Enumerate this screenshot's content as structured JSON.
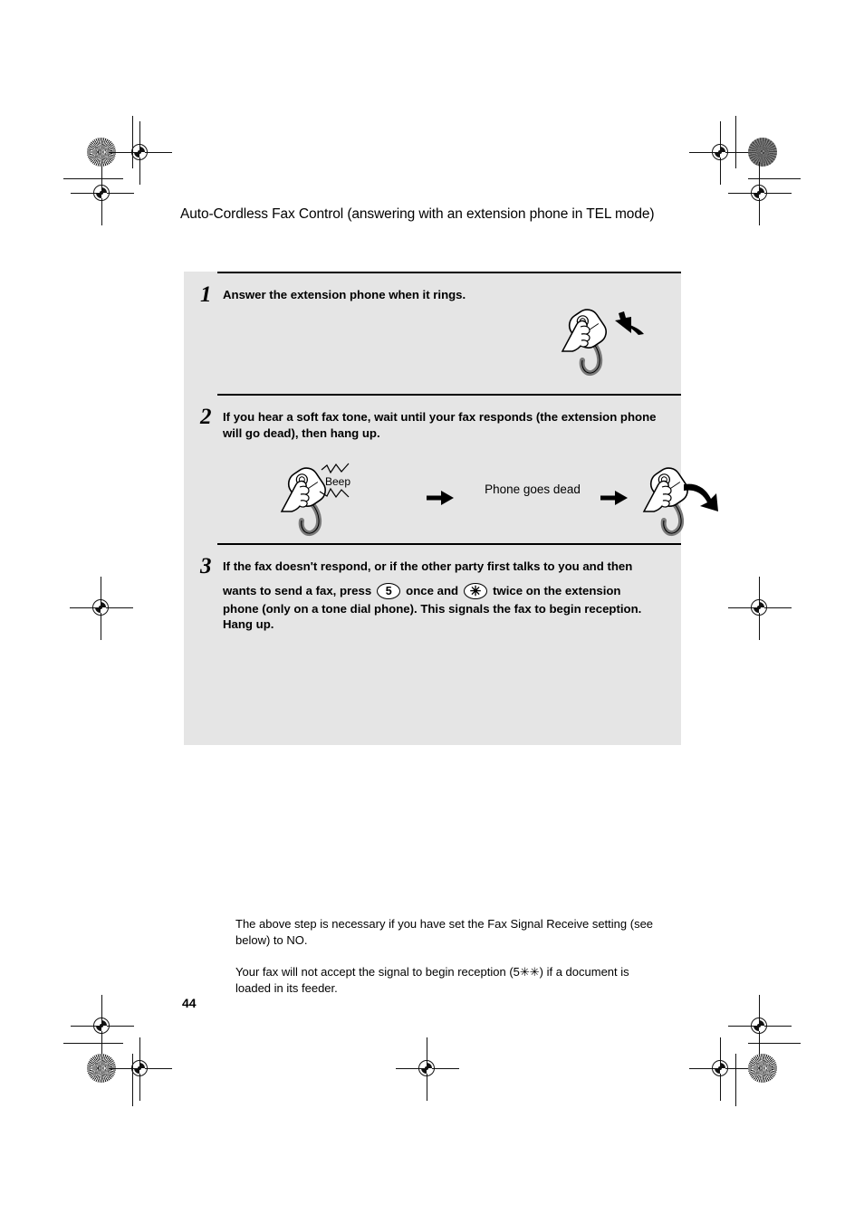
{
  "page": {
    "title": "Auto-Cordless Fax Control (answering with an extension phone in TEL mode)",
    "number": "44",
    "background_color": "#ffffff",
    "panel_color": "#e5e5e5"
  },
  "steps": [
    {
      "number": "1",
      "text": "Answer the extension phone when it rings.",
      "illustration": {
        "name": "hand-lifting-handset",
        "arrow": "arrow-up-left"
      }
    },
    {
      "number": "2",
      "text": "If you hear a soft fax tone, wait until your fax responds (the extension phone will go dead), then hang up.",
      "illustration": {
        "beep_label": "Beep",
        "middle_label": "Phone goes dead",
        "left_phone": "hand-holding-handset-beeping",
        "right_phone": "hand-hanging-up-handset",
        "arrow_1": "arrow-right",
        "arrow_2": "arrow-right"
      }
    },
    {
      "number": "3",
      "text_part_1": "If the fax doesn't respond, or if the other party first talks to you and then",
      "text_part_2a": "wants to send a fax, press",
      "key_1": "5",
      "text_part_2b": "once and",
      "key_2": "✳",
      "text_part_2c": "twice on the extension",
      "text_part_3": "phone (only on a tone dial phone). This signals the fax to begin reception. Hang up.",
      "notes": [
        "The above step is necessary if you have set the Fax Signal Receive setting (see below) to NO.",
        "Your fax will not accept the signal to begin reception (5✳✳) if a document is loaded in its feeder."
      ]
    }
  ],
  "print_marks": {
    "registration_target": "registration-target",
    "star_dot": "star-density-dot",
    "solid_dot": "solid-density-dot",
    "trim_line": "trim-line"
  }
}
